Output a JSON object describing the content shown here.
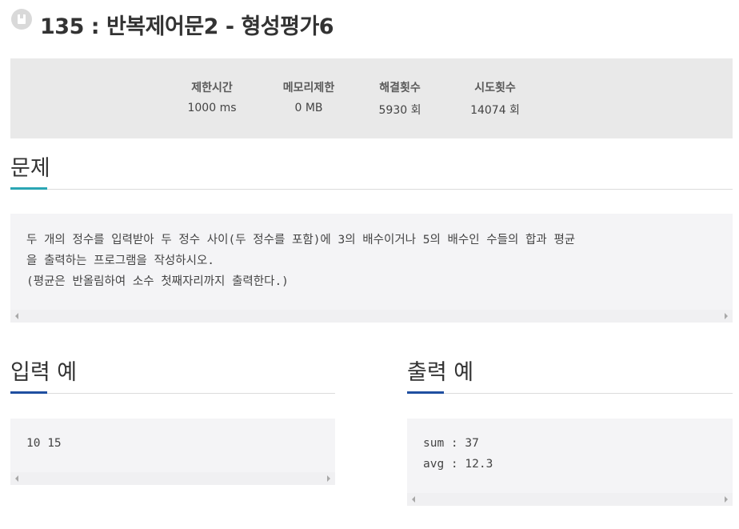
{
  "title": "135 : 반복제어문2 - 형성평가6",
  "bookmark_icon": "bookmark-icon",
  "stats": [
    {
      "label": "제한시간",
      "value": "1000 ms"
    },
    {
      "label": "메모리제한",
      "value": "0 MB"
    },
    {
      "label": "해결횟수",
      "value": "5930 회"
    },
    {
      "label": "시도횟수",
      "value": "14074 회"
    }
  ],
  "problem": {
    "heading": "문제",
    "accent_color": "#2aa6b4",
    "lines": [
      "두 개의 정수를 입력받아 두 정수 사이(두 정수를 포함)에 3의 배수이거나 5의 배수인 수들의 합과 평균",
      "을 출력하는 프로그램을 작성하시오.",
      "(평균은 반올림하여 소수 첫째자리까지 출력한다.)"
    ]
  },
  "input_example": {
    "heading": "입력 예",
    "accent_color": "#1f4fa0",
    "lines": [
      "10 15"
    ]
  },
  "output_example": {
    "heading": "출력 예",
    "accent_color": "#1f4fa0",
    "lines": [
      "sum : 37",
      "avg : 12.3"
    ]
  }
}
